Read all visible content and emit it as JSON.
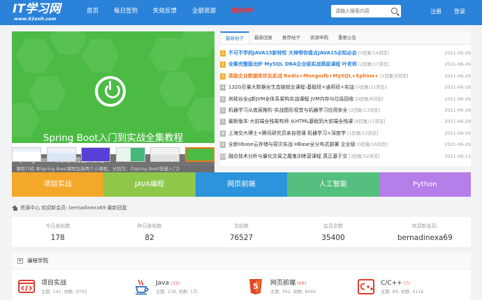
{
  "header": {
    "logo": "IT学习网",
    "logo_sub": "www.52xxit.com",
    "nav": [
      "首页",
      "每日签到",
      "失效反馈",
      "全部资源",
      "购买VIP"
    ],
    "search_placeholder": "请输入搜索内容",
    "login": "注册",
    "register": "登录",
    "bg_color": "#2b82d9",
    "vip_color": "#ff2b2b"
  },
  "banner": {
    "big_title": "Spring Boot入门到实战全集教程",
    "caption_title": "Spring Boot入门到实战全集教程",
    "caption_desc": "课程介绍 本Spring Boot课程包括两个小课程，分别为：《Spring Boot快速入门》",
    "bg_color": "#4bbb44"
  },
  "tabs": [
    "最新帖子",
    "最新回复",
    "推荐帖子",
    "资源申购",
    "重要公告"
  ],
  "posts": [
    {
      "rank": "1",
      "title": "不可不学的JAVA15新特性 大神带你盘点JAVA15必知必会",
      "meta": " [0回复/14浏览]",
      "date": "2021-06-29",
      "style": "blue"
    },
    {
      "rank": "2",
      "title": "全集完整版出炉 MySQL DBA企业级实战高级课程 叶老师",
      "meta": " [2回复/17浏览]",
      "date": "2021-06-29",
      "style": "blue"
    },
    {
      "rank": "3",
      "title": "高级企业数据库优化实战 Redis+Mongodb+MySQL+Sphinx+",
      "meta": " [1回复/9浏览]",
      "date": "2021-06-29",
      "style": "orange"
    },
    {
      "rank": "4",
      "title": "132G巨量大数据全生态链就业课程-基础班+通用班+实战",
      "meta": " [0回复/11浏览]",
      "date": "2021-06-29",
      "style": ""
    },
    {
      "rank": "5",
      "title": "尚硅谷全g新JVM全体系架构实战课程 JVM内存与垃圾回收",
      "meta": " [0回复/8浏览]",
      "date": "2021-06-29",
      "style": ""
    },
    {
      "rank": "6",
      "title": "机器学习从底层推阶-实战图形视觉与机器学习应用安全",
      "meta": " [2回复/13浏览]",
      "date": "2021-06-29",
      "style": ""
    },
    {
      "rank": "7",
      "title": "最新版本-大前端全栈架构师 从HTML基础到大前端全栈课",
      "meta": " [6回复/27浏览]",
      "date": "2021-06-29",
      "style": ""
    },
    {
      "rank": "8",
      "title": "上海交大博士+腾讯研究员亲自授课 机器学习+深度学",
      "meta": " [1回复/13浏览]",
      "date": "2021-06-29",
      "style": ""
    },
    {
      "rank": "9",
      "title": "全新Hbase云存储与容灾实战 HBase全分布式部署 企业级",
      "meta": " [0回复/16浏览]",
      "date": "2021-06-29",
      "style": ""
    },
    {
      "rank": "10",
      "title": "融合技术分析与量化交易之魔鬼训练营课程 真正基于交",
      "meta": " [3回复/52浏览]",
      "date": "2021-06-12",
      "style": ""
    }
  ],
  "categories": [
    {
      "label": "项目实战",
      "color": "#f4a82a"
    },
    {
      "label": "JAVA编程",
      "color": "#8fc74a"
    },
    {
      "label": "网页前端",
      "color": "#2b94dd"
    },
    {
      "label": "人工智能",
      "color": "#54bf7e"
    },
    {
      "label": "Python",
      "color": "#b57ee8"
    }
  ],
  "breadcrumb": "资源中心   欢迎新会员: bernadinexa69    最新回复",
  "stats": [
    {
      "label": "今日发帖数",
      "value": "178"
    },
    {
      "label": "昨日发帖数",
      "value": "82"
    },
    {
      "label": "总帖数",
      "value": "76527"
    },
    {
      "label": "会员总数",
      "value": "35400"
    },
    {
      "label": "欢迎新会员:",
      "value": "bernadinexa69"
    }
  ],
  "section": {
    "title": "编程学院",
    "forums": [
      {
        "name": "项目实战",
        "count": "",
        "stats": "主题: 141, 帖数: 9702",
        "icon": "code-window-icon"
      },
      {
        "name": "Java",
        "count": " (33)",
        "stats": "主题: 239, 帖数: 1万",
        "icon": "java-cup-icon"
      },
      {
        "name": "网页前端",
        "count": " (68)",
        "stats": "主题: 362, 帖数: 8060",
        "icon": "html5-icon"
      },
      {
        "name": "C/C++",
        "count": " (7)",
        "stats": "主题: 84, 帖数: 4116",
        "icon": "cpp-icon"
      }
    ]
  }
}
